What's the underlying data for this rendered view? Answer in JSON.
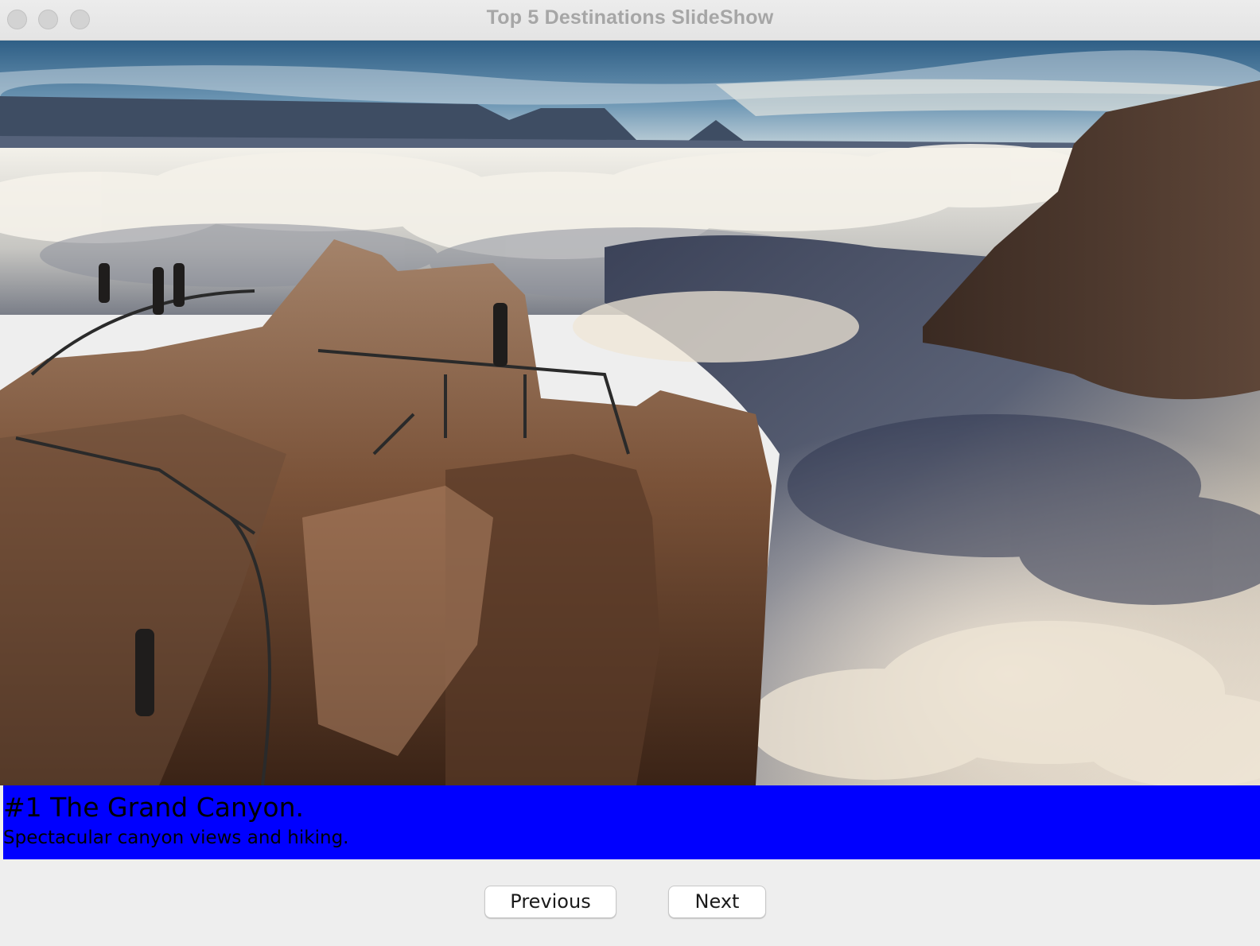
{
  "window": {
    "title": "Top 5 Destinations SlideShow"
  },
  "slide": {
    "title": "#1 The Grand Canyon.",
    "description": "Spectacular canyon views and hiking.",
    "caption_background": "#0000ff",
    "caption_text_color": "#000000"
  },
  "controls": {
    "previous_label": "Previous",
    "next_label": "Next"
  }
}
